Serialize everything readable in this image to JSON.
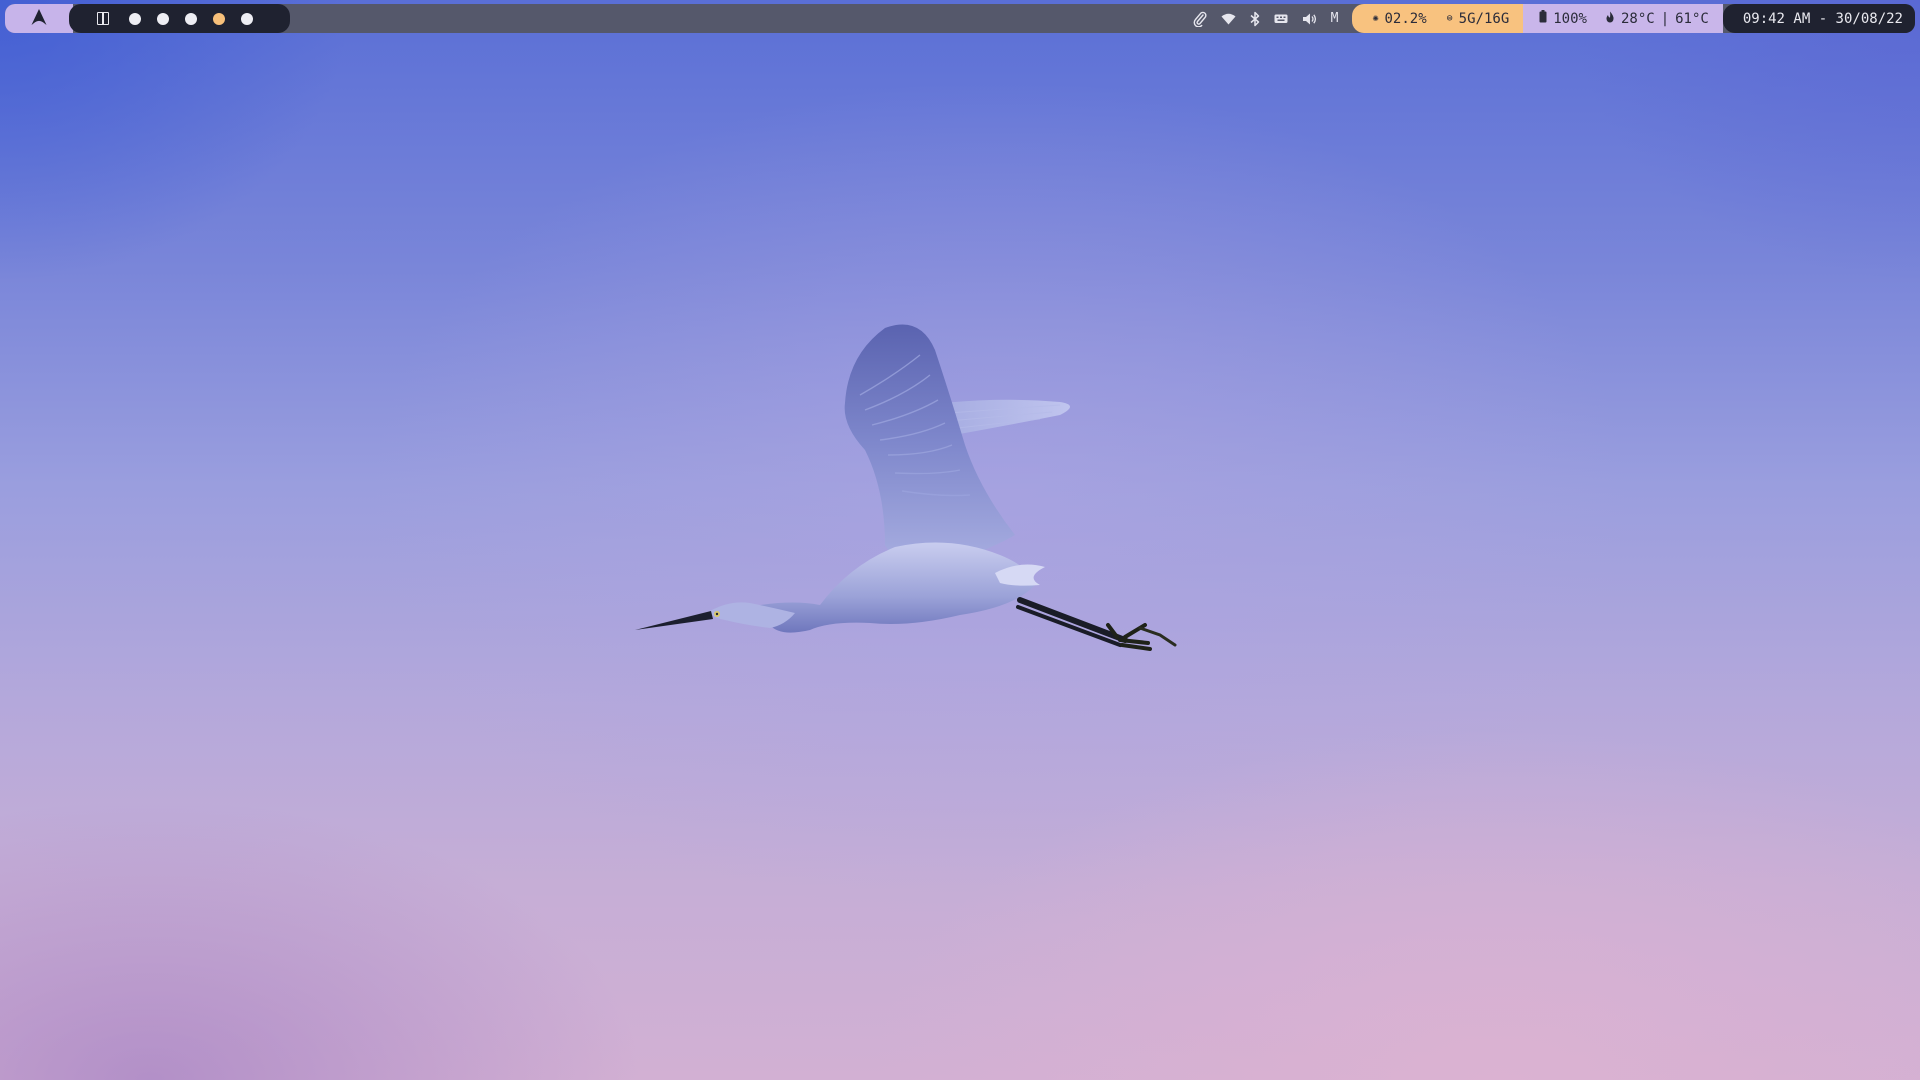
{
  "launcher": {
    "icon": "arch-logo-icon"
  },
  "workspaces": {
    "layout_icon": "layout-split-icon",
    "items": [
      {
        "name": "workspace-1",
        "active": false
      },
      {
        "name": "workspace-2",
        "active": false
      },
      {
        "name": "workspace-3",
        "active": false
      },
      {
        "name": "workspace-4",
        "active": true
      },
      {
        "name": "workspace-5",
        "active": false
      }
    ],
    "active_color": "#f7c07a"
  },
  "tray": {
    "icons": [
      "paperclip-icon",
      "wifi-icon",
      "bluetooth-icon",
      "keyboard-icon",
      "volume-icon"
    ],
    "mic_label": "M"
  },
  "system": {
    "cpu": "02.2%",
    "memory": "5G/16G",
    "battery": "100%",
    "temp_cpu": "28°C",
    "separator": "|",
    "temp_gpu": "61°C",
    "accent_color": "#f8c27f",
    "stats_color": "#c9b6ea"
  },
  "clock": {
    "text": "09:42 AM - 30/08/22"
  },
  "wallpaper": {
    "subject": "egret-in-flight"
  }
}
